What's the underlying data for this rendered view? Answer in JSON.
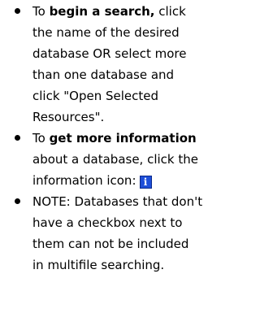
{
  "help": {
    "items": [
      {
        "prefix": "To ",
        "bold": "begin a search,",
        "text": " click the name of the desired database OR select more than one database and click \"Open Selected Resources\"."
      },
      {
        "prefix": "To ",
        "bold": "get more information",
        "text": " about a database, click the information icon:",
        "icon": "info-icon",
        "icon_label": "i",
        "icon_color": "#1f4fd8"
      },
      {
        "text": "NOTE: Databases that don't have a checkbox next to them can not be included in multifile searching."
      }
    ]
  }
}
